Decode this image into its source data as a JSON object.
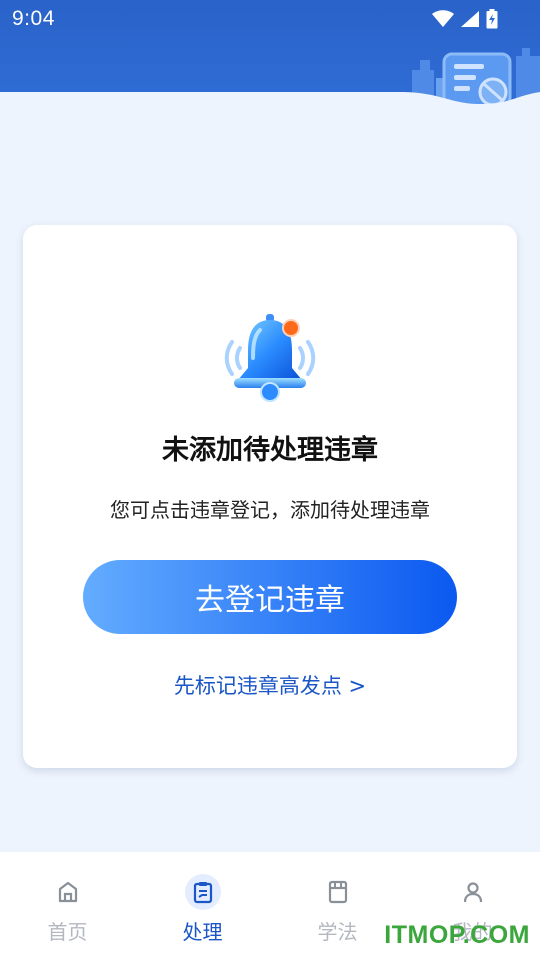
{
  "status_bar": {
    "time": "9:04",
    "icons": [
      "wifi-icon",
      "cellular-signal-icon",
      "battery-charging-icon"
    ]
  },
  "header": {
    "illustration": "city-document-prohibited-illustration",
    "color": "#2f6dd6"
  },
  "empty_state": {
    "icon": "bell-notification-icon",
    "title": "未添加待处理违章",
    "description": "您可点击违章登记，添加待处理违章",
    "primary_button": "去登记违章",
    "link": "先标记违章高发点 >"
  },
  "tabbar": {
    "items": [
      {
        "label": "首页",
        "icon": "home-icon",
        "active": false
      },
      {
        "label": "处理",
        "icon": "clipboard-edit-icon",
        "active": true
      },
      {
        "label": "学法",
        "icon": "book-icon",
        "active": false
      },
      {
        "label": "我的",
        "icon": "person-icon",
        "active": false
      }
    ]
  },
  "watermark": "ITMOP.COM",
  "colors": {
    "primary": "#0b59f0",
    "primary_light": "#63acff",
    "link": "#1a56c6",
    "background": "#eef4fd",
    "inactive_tab": "#b3b8c0"
  }
}
